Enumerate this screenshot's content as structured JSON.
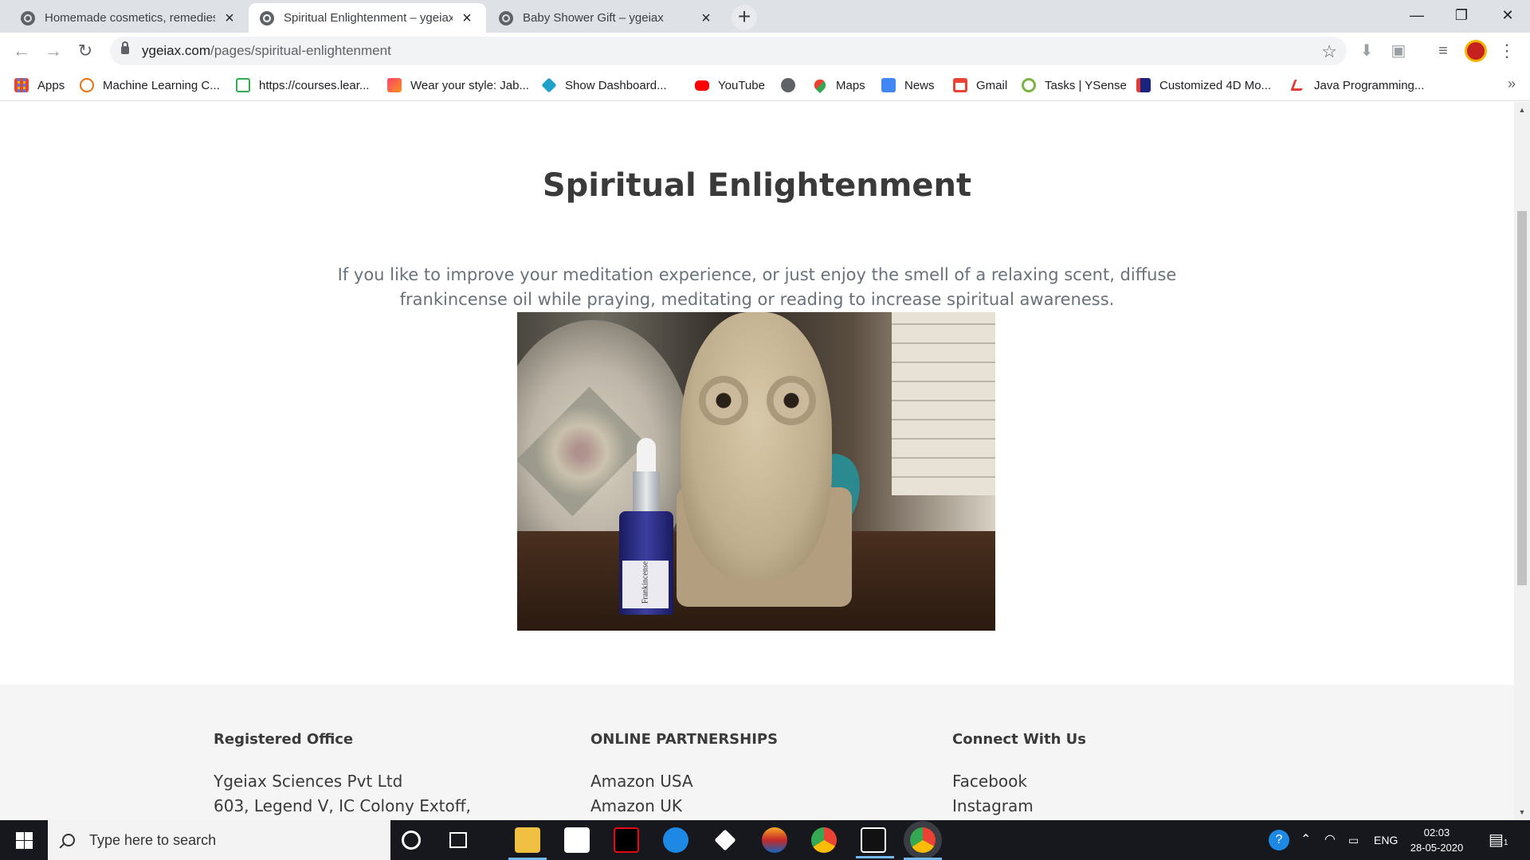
{
  "browser": {
    "tabs": [
      {
        "title": "Homemade cosmetics, remedies",
        "active": false
      },
      {
        "title": "Spiritual Enlightenment – ygeiax",
        "active": true
      },
      {
        "title": "Baby Shower Gift – ygeiax",
        "active": false
      }
    ],
    "url_host": "ygeiax.com",
    "url_path": "/pages/spiritual-enlightenment",
    "bookmarks": [
      {
        "label": "Apps",
        "icon": "apps-grid-icon"
      },
      {
        "label": "Machine Learning C...",
        "icon": "code-icon"
      },
      {
        "label": "https://courses.lear...",
        "icon": "play-icon"
      },
      {
        "label": "Wear your style: Jab...",
        "icon": "myntra-icon"
      },
      {
        "label": "Show Dashboard...",
        "icon": "diamond-icon"
      },
      {
        "label": "YouTube",
        "icon": "youtube-icon"
      },
      {
        "label": "",
        "icon": "globe-icon"
      },
      {
        "label": "Maps",
        "icon": "maps-icon"
      },
      {
        "label": "News",
        "icon": "news-icon"
      },
      {
        "label": "Gmail",
        "icon": "gmail-icon"
      },
      {
        "label": "Tasks | YSense",
        "icon": "ysense-icon"
      },
      {
        "label": "Customized 4D Mo...",
        "icon": "4d-icon"
      },
      {
        "label": "Java Programming...",
        "icon": "java-icon"
      }
    ]
  },
  "page": {
    "title": "Spiritual Enlightenment",
    "intro": "If you like to improve your meditation experience, or just enjoy the smell of a relaxing scent, diffuse frankincense oil while praying, meditating or reading to increase spiritual awareness.",
    "image_label": "Frankincense"
  },
  "footer": {
    "columns": [
      {
        "heading": "Registered Office",
        "lines": [
          "Ygeiax Sciences Pvt Ltd",
          "603, Legend V, IC Colony Extoff,"
        ]
      },
      {
        "heading": "ONLINE PARTNERSHIPS",
        "lines": [
          "Amazon USA",
          "Amazon UK"
        ]
      },
      {
        "heading": "Connect With Us",
        "lines": [
          "Facebook",
          "Instagram"
        ]
      }
    ]
  },
  "taskbar": {
    "search_placeholder": "Type here to search",
    "language": "ENG",
    "time": "02:03",
    "date": "28-05-2020",
    "notification_count": "1"
  }
}
